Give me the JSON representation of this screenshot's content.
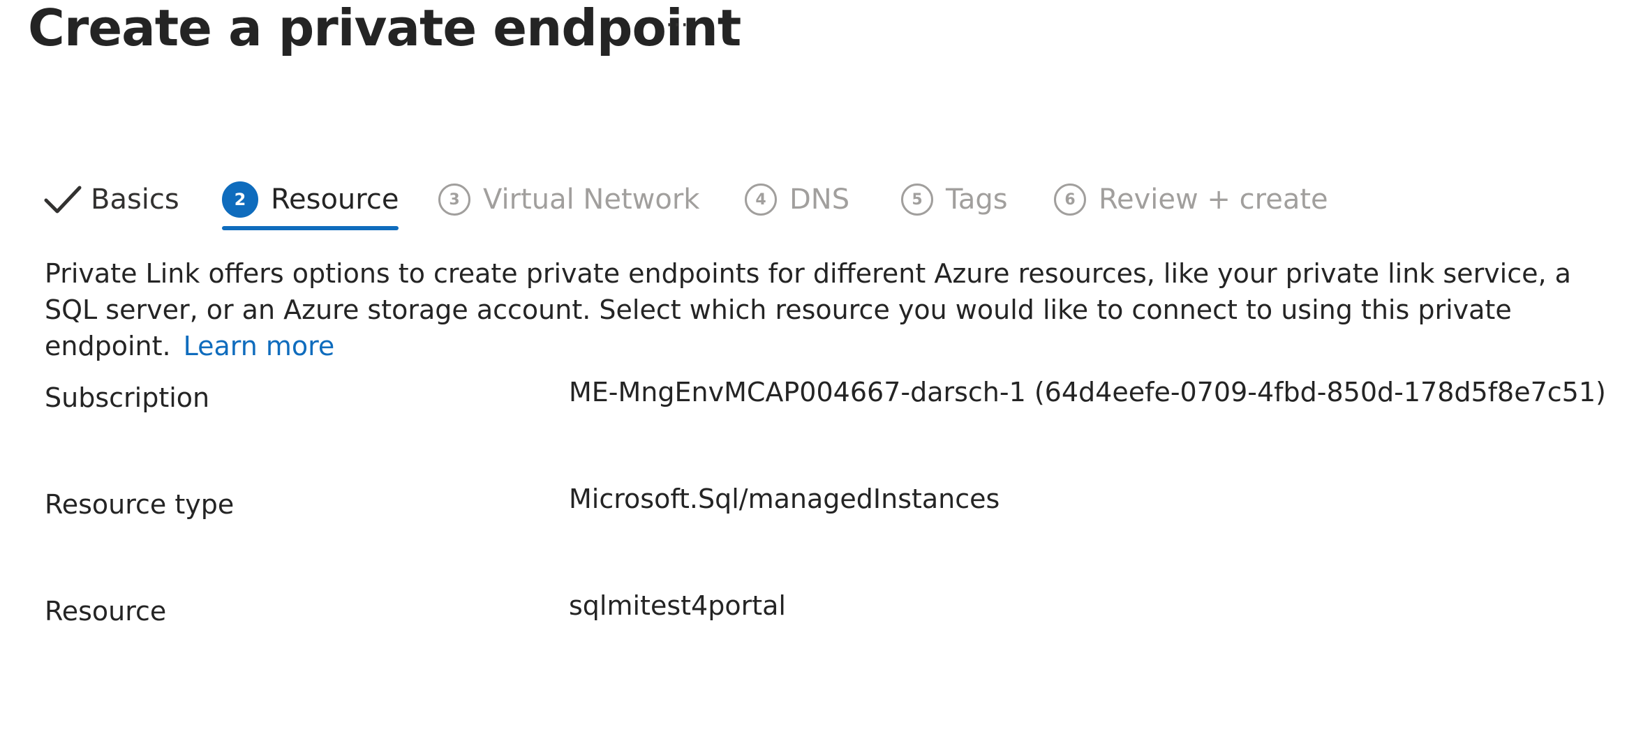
{
  "header": {
    "title": "Create a private endpoint",
    "more_label": "···"
  },
  "tabs": [
    {
      "label": "Basics",
      "step": "1",
      "state": "completed",
      "icon": "checkmark-icon"
    },
    {
      "label": "Resource",
      "step": "2",
      "state": "active"
    },
    {
      "label": "Virtual Network",
      "step": "3",
      "state": "upcoming"
    },
    {
      "label": "DNS",
      "step": "4",
      "state": "upcoming"
    },
    {
      "label": "Tags",
      "step": "5",
      "state": "upcoming"
    },
    {
      "label": "Review + create",
      "step": "6",
      "state": "upcoming"
    }
  ],
  "description": {
    "text": "Private Link offers options to create private endpoints for different Azure resources, like your private link service, a SQL server, or an Azure storage account. Select which resource you would like to connect to using this private endpoint.",
    "link_label": "Learn more"
  },
  "fields": [
    {
      "label": "Subscription",
      "value": "ME-MngEnvMCAP004667-darsch-1 (64d4eefe-0709-4fbd-850d-178d5f8e7c51)"
    },
    {
      "label": "Resource type",
      "value": "Microsoft.Sql/managedInstances"
    },
    {
      "label": "Resource",
      "value": "sqlmitest4portal"
    }
  ],
  "colors": {
    "accent": "#0f6cbd",
    "text": "#242424",
    "disabled": "#a19f9d"
  }
}
